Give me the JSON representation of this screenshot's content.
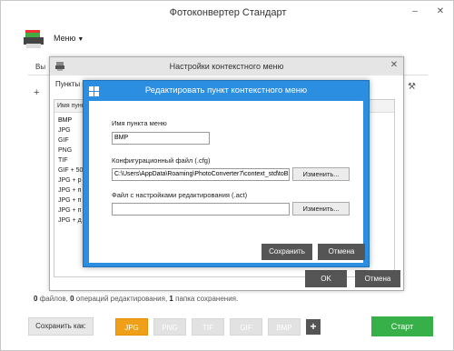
{
  "app": {
    "title": "Фотоконвертер Стандарт",
    "menu_label": "Меню",
    "bg_tab_label": "Вы",
    "stats": {
      "files": "0",
      "files_label": "файлов,",
      "ops": "0",
      "ops_label": "операций редактирования,",
      "folders": "1",
      "folders_label": "папка сохранения."
    }
  },
  "savebar": {
    "label": "Сохранить как:",
    "formats": [
      "JPG",
      "PNG",
      "TIF",
      "GIF",
      "BMP"
    ],
    "active_format": "JPG",
    "add_symbol": "+",
    "start_label": "Старт"
  },
  "context_dialog": {
    "title": "Настройки контекстного меню",
    "list_label": "Пункты к",
    "column_header": "Имя пунк",
    "items": [
      "BMP",
      "JPG",
      "GIF",
      "PNG",
      "TIF",
      "GIF + 50",
      "JPG + р",
      "JPG + п",
      "JPG + п",
      "JPG + п",
      "JPG + д"
    ],
    "ok_label": "OK",
    "cancel_label": "Отмена"
  },
  "edit_dialog": {
    "title": "Редактировать пункт контекстного меню",
    "name_label": "Имя пункта меню",
    "name_value": "BMP",
    "config_label": "Конфигурационный файл (.cfg)",
    "config_value": "C:\\Users\\AppData\\Roaming\\PhotoConverter7\\context_std\\toBMP",
    "config_button": "Изменить...",
    "act_label": "Файл с настройками редактирования (.act)",
    "act_value": "",
    "act_button": "Изменить...",
    "save_label": "Сохранить",
    "cancel_label": "Отмена"
  },
  "colors": {
    "accent_blue": "#2b8ee0",
    "active_format": "#f0a018",
    "start_green": "#38b04a",
    "dark_button": "#555555"
  }
}
